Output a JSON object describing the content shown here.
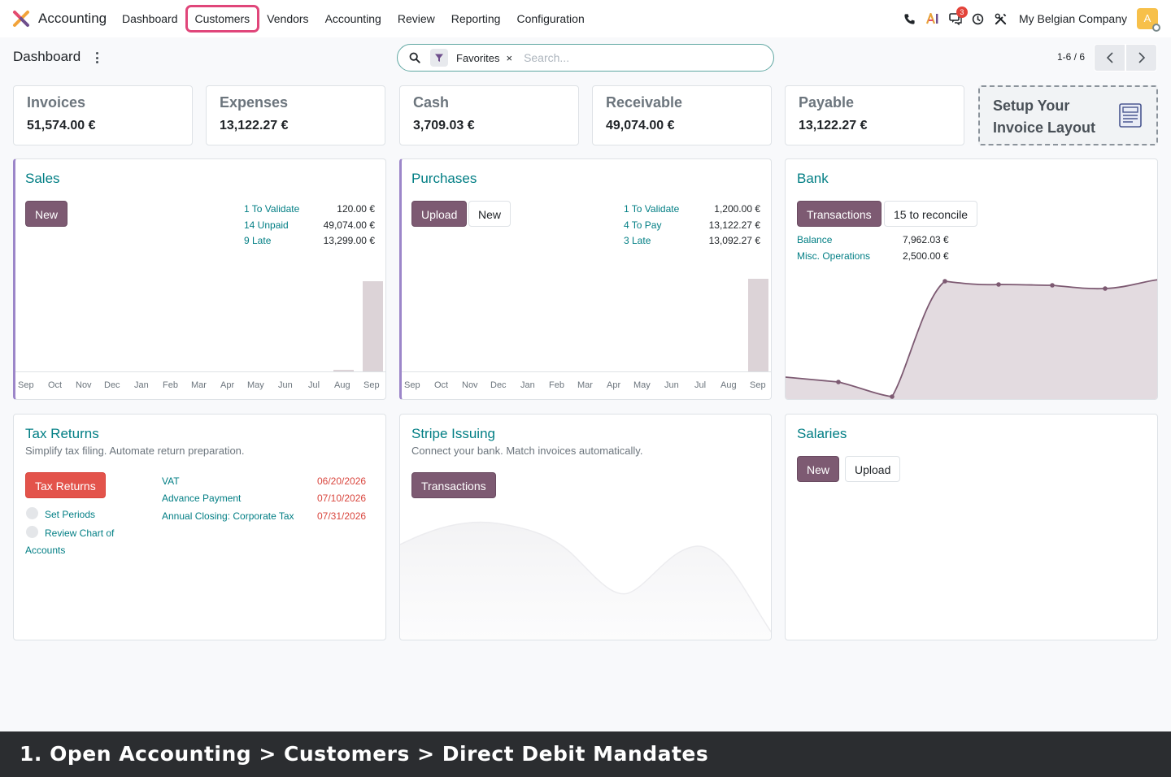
{
  "navbar": {
    "app_name": "Accounting",
    "menu": [
      "Dashboard",
      "Customers",
      "Vendors",
      "Accounting",
      "Review",
      "Reporting",
      "Configuration"
    ],
    "messages_badge": "3",
    "company": "My Belgian Company",
    "avatar_letter": "A"
  },
  "control": {
    "title": "Dashboard",
    "facet_label": "Favorites",
    "facet_close": "×",
    "search_placeholder": "Search...",
    "pager": "1-6 / 6"
  },
  "kpis": [
    {
      "title": "Invoices",
      "value": "51,574.00 €"
    },
    {
      "title": "Expenses",
      "value": "13,122.27 €"
    },
    {
      "title": "Cash",
      "value": "3,709.03 €"
    },
    {
      "title": "Receivable",
      "value": "49,074.00 €"
    },
    {
      "title": "Payable",
      "value": "13,122.27 €"
    }
  ],
  "setup": {
    "text": "Setup Your Invoice Layout"
  },
  "months": [
    "Sep",
    "Oct",
    "Nov",
    "Dec",
    "Jan",
    "Feb",
    "Mar",
    "Apr",
    "May",
    "Jun",
    "Jul",
    "Aug",
    "Sep"
  ],
  "sales": {
    "title": "Sales",
    "new_label": "New",
    "stats": [
      {
        "label": "1 To Validate",
        "value": "120.00 €"
      },
      {
        "label": "14 Unpaid",
        "value": "49,074.00 €"
      },
      {
        "label": "9 Late",
        "value": "13,299.00 €"
      }
    ]
  },
  "purchases": {
    "title": "Purchases",
    "upload_label": "Upload",
    "new_label": "New",
    "stats": [
      {
        "label": "1 To Validate",
        "value": "1,200.00 €"
      },
      {
        "label": "4 To Pay",
        "value": "13,122.27 €"
      },
      {
        "label": "3 Late",
        "value": "13,092.27 €"
      }
    ]
  },
  "bank": {
    "title": "Bank",
    "transactions_label": "Transactions",
    "reconcile_label": "15 to reconcile",
    "stats": [
      {
        "label": "Balance",
        "value": "7,962.03 €"
      },
      {
        "label": "Misc. Operations",
        "value": "2,500.00 €"
      }
    ]
  },
  "tax": {
    "title": "Tax Returns",
    "subtitle": "Simplify tax filing. Automate return preparation.",
    "button_label": "Tax Returns",
    "step1": "Set Periods",
    "step2_a": "Review Chart of",
    "step2_b": "Accounts",
    "deadlines": [
      {
        "label": "VAT",
        "date": "06/20/2026"
      },
      {
        "label": "Advance Payment",
        "date": "07/10/2026"
      },
      {
        "label": "Annual Closing: Corporate Tax",
        "date": "07/31/2026"
      }
    ]
  },
  "stripe": {
    "title": "Stripe Issuing",
    "subtitle": "Connect your bank. Match invoices automatically.",
    "button_label": "Transactions"
  },
  "salaries": {
    "title": "Salaries",
    "new_label": "New",
    "upload_label": "Upload"
  },
  "caption": "1. Open Accounting > Customers > Direct Debit Mandates",
  "colors": {
    "primary": "#7d5a72",
    "link": "#017e84",
    "danger": "#e3534b",
    "highlight": "#e0467a"
  }
}
